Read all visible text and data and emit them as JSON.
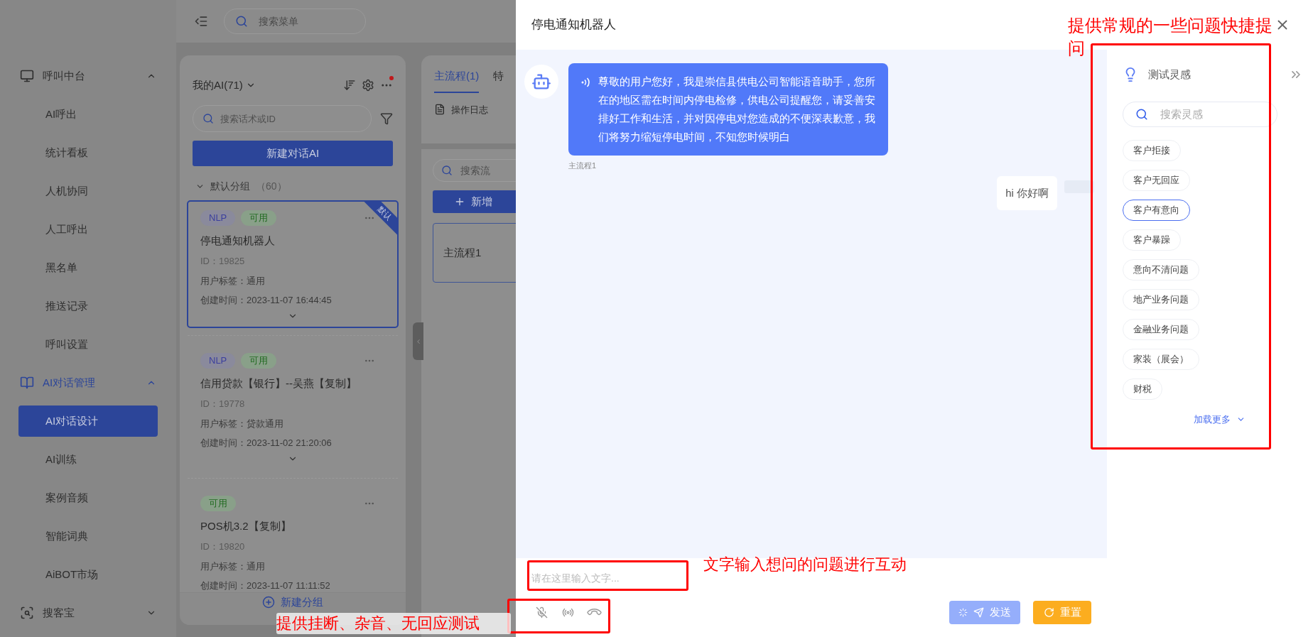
{
  "menu_search": {
    "placeholder": "搜索菜单"
  },
  "sidebar": {
    "items": [
      {
        "label": "呼叫中台",
        "selected": false,
        "expanded": true,
        "children": [
          {
            "label": "AI呼出",
            "selected": false
          },
          {
            "label": "统计看板",
            "selected": false
          },
          {
            "label": "人机协同",
            "selected": false
          },
          {
            "label": "人工呼出",
            "selected": false
          },
          {
            "label": "黑名单",
            "selected": false
          },
          {
            "label": "推送记录",
            "selected": false
          },
          {
            "label": "呼叫设置",
            "selected": false
          }
        ]
      },
      {
        "label": "AI对话管理",
        "selected": true,
        "expanded": true,
        "children": [
          {
            "label": "AI对话设计",
            "selected": true
          },
          {
            "label": "AI训练",
            "selected": false
          },
          {
            "label": "案例音频",
            "selected": false
          },
          {
            "label": "智能词典",
            "selected": false
          },
          {
            "label": "AiBOT市场",
            "selected": false
          }
        ]
      },
      {
        "label": "搜客宝",
        "selected": false,
        "expanded": false
      }
    ]
  },
  "ai_panel": {
    "title": "我的AI(71)",
    "notification": true,
    "search": {
      "placeholder": "搜索话术或ID"
    },
    "new_button": "新建对话AI",
    "group": {
      "label": "默认分组",
      "count": "（60）",
      "expanded": true
    },
    "cards": [
      {
        "tags": [
          {
            "text": "NLP",
            "kind": "type"
          },
          {
            "text": "可用",
            "kind": "status"
          }
        ],
        "name": "停电通知机器人",
        "id": "ID：19825",
        "user_tag": "用户标签：通用",
        "created": "创建时间：2023-11-07 16:44:45",
        "ribbon": "默认",
        "selected": true,
        "expandable": true
      },
      {
        "tags": [
          {
            "text": "NLP",
            "kind": "type"
          },
          {
            "text": "可用",
            "kind": "status"
          }
        ],
        "name": "信用贷款【银行】--吴燕【复制】",
        "id": "ID：19778",
        "user_tag": "用户标签：贷款通用",
        "created": "创建时间：2023-11-02 21:20:06",
        "selected": false,
        "expandable": true
      },
      {
        "tags": [
          {
            "text": "可用",
            "kind": "status"
          }
        ],
        "name": "POS机3.2【复制】",
        "id": "ID：19820",
        "user_tag": "用户标签：通用",
        "created": "创建时间：2023-11-07 11:11:52",
        "selected": false,
        "expandable": false
      }
    ],
    "footer_button": "新建分组"
  },
  "flow_panel": {
    "tabs": [
      {
        "label": "主流程(1)",
        "selected": true
      },
      {
        "label": "特",
        "selected": false
      }
    ],
    "log_button": "操作日志",
    "search": {
      "placeholder": "搜索流"
    },
    "add_button": "新增",
    "flows": [
      "主流程1"
    ]
  },
  "drawer": {
    "title": "停电通知机器人",
    "messages": [
      {
        "kind": "bot",
        "text": "尊敬的用户您好，我是崇信县供电公司智能语音助手，您所在的地区需在时间内停电检修，供电公司提醒您，请妥善安排好工作和生活，并对因停电对您造成的不便深表歉意，我们将努力缩短停电时间，不知您时候明白",
        "caption": "主流程1"
      },
      {
        "kind": "user",
        "text": "hi 你好啊"
      }
    ],
    "input": {
      "placeholder": "请在这里输入文字..."
    },
    "send_button": {
      "label": "发送",
      "loading": true
    },
    "reset_button": "重置",
    "inspiration": {
      "title": "测试灵感",
      "search": {
        "placeholder": "搜索灵感"
      },
      "suggestions": [
        {
          "label": "客户拒接",
          "selected": false
        },
        {
          "label": "客户无回应",
          "selected": false
        },
        {
          "label": "客户有意向",
          "selected": true
        },
        {
          "label": "客户暴躁",
          "selected": false
        },
        {
          "label": "意向不清问题",
          "selected": false
        },
        {
          "label": "地产业务问题",
          "selected": false
        },
        {
          "label": "金融业务问题",
          "selected": false
        },
        {
          "label": "家装（展会）",
          "selected": false
        },
        {
          "label": "财税",
          "selected": false
        }
      ],
      "load_more": "加载更多"
    }
  },
  "annotations": [
    "提供常规的一些问题快捷提问",
    "文字输入想问的问题进行互动",
    "提供挂断、杂音、无回应测试"
  ]
}
